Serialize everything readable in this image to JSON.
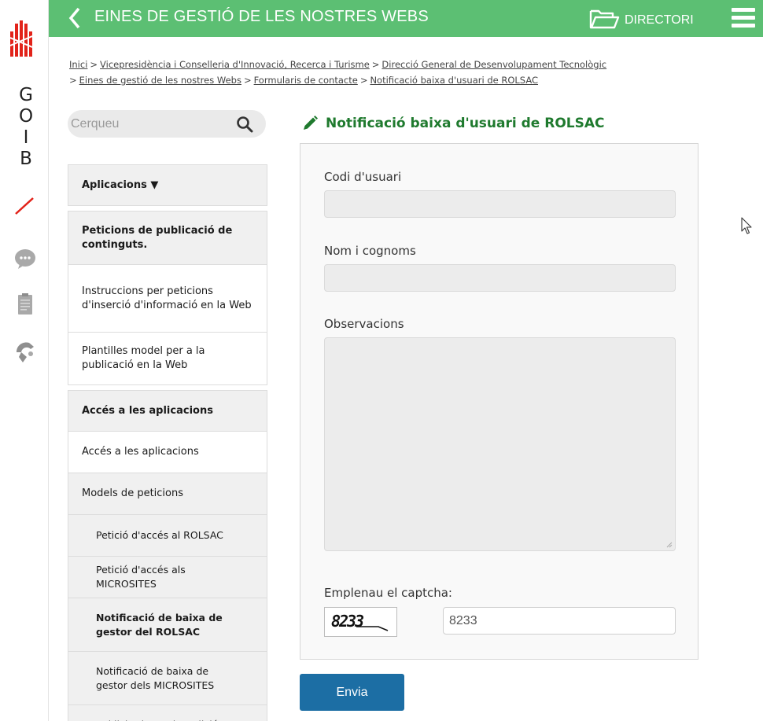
{
  "brand": {
    "letters": [
      "G",
      "O",
      "I",
      "B"
    ],
    "colors": {
      "red": "#e2231a",
      "green": "#5cbf73",
      "blue": "#1c6ea4",
      "title_green": "#1f7a2e"
    },
    "rail_icons": [
      "chat-icon",
      "clipboard-icon",
      "accessibility-icon"
    ]
  },
  "topbar": {
    "title": "EINES DE GESTIÓ DE LES NOSTRES WEBS",
    "directory_label": "DIRECTORI"
  },
  "breadcrumb": [
    "Inici",
    "Vicepresidència i Conselleria d'Innovació, Recerca i Turisme",
    "Direcció General de Desenvolupament Tecnològic",
    "Eines de gestió de les nostres Webs",
    "Formularis de contacte",
    "Notificació baixa d'usuari de ROLSAC"
  ],
  "search": {
    "placeholder": "Cerqueu"
  },
  "sidebar": {
    "section_apps": "Aplicacions ▼",
    "section_pub": "Peticions de publicació de continguts.",
    "item_instr": "Instruccions per peticions d'inserció d'informació en la Web",
    "item_templates": "Plantilles model per a la publicació en la Web",
    "section_access": "Accés a les aplicacions",
    "item_access": "Accés a les aplicacions",
    "item_models": "Models de peticions",
    "sub_rolsac": "Petició d'accés al ROLSAC",
    "sub_microsites": "Petició d'accés als MICROSITES",
    "sub_baixa_rolsac": "Notificació de baixa de gestor del ROLSAC",
    "sub_baixa_micro": "Notificació de baixa de gestor dels MICROSITES",
    "sub_sollicitud": "Sol·licitud permiss edició"
  },
  "form": {
    "title": "Notificació baixa d'usuari de ROLSAC",
    "label_code": "Codi d'usuari",
    "label_name": "Nom i cognoms",
    "label_obs": "Observacions",
    "label_captcha": "Emplenau el captcha:",
    "captcha_image_text": "8233",
    "captcha_value": "8233",
    "submit_label": "Envia"
  }
}
